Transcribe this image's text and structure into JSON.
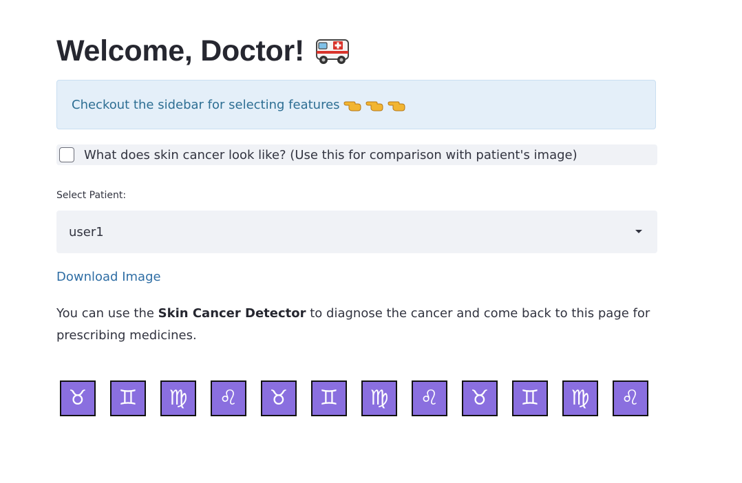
{
  "header": {
    "title": "Welcome, Doctor!",
    "title_emoji": "ambulance-emoji"
  },
  "info": {
    "text": "Checkout the sidebar for selecting features",
    "emoji": "pointing-left-hand"
  },
  "checkbox": {
    "label": "What does skin cancer look like? (Use this for comparison with patient's image)",
    "checked": false
  },
  "patient_select": {
    "label": "Select Patient:",
    "selected": "user1"
  },
  "download_link": "Download Image",
  "paragraph": {
    "prefix": "You can use the ",
    "bold": "Skin Cancer Detector",
    "suffix": " to diagnose the cancer and come back to this page for prescribing medicines."
  },
  "zodiac_symbols": [
    "♉",
    "♊",
    "♍",
    "♌",
    "♉",
    "♊",
    "♍",
    "♌",
    "♉",
    "♊",
    "♍",
    "♌"
  ],
  "colors": {
    "info_bg": "#e4eff9",
    "info_text": "#2d6e93",
    "link": "#2e6da4",
    "widget_bg": "#f0f2f6",
    "zodiac_bg": "#8a6fdf"
  }
}
